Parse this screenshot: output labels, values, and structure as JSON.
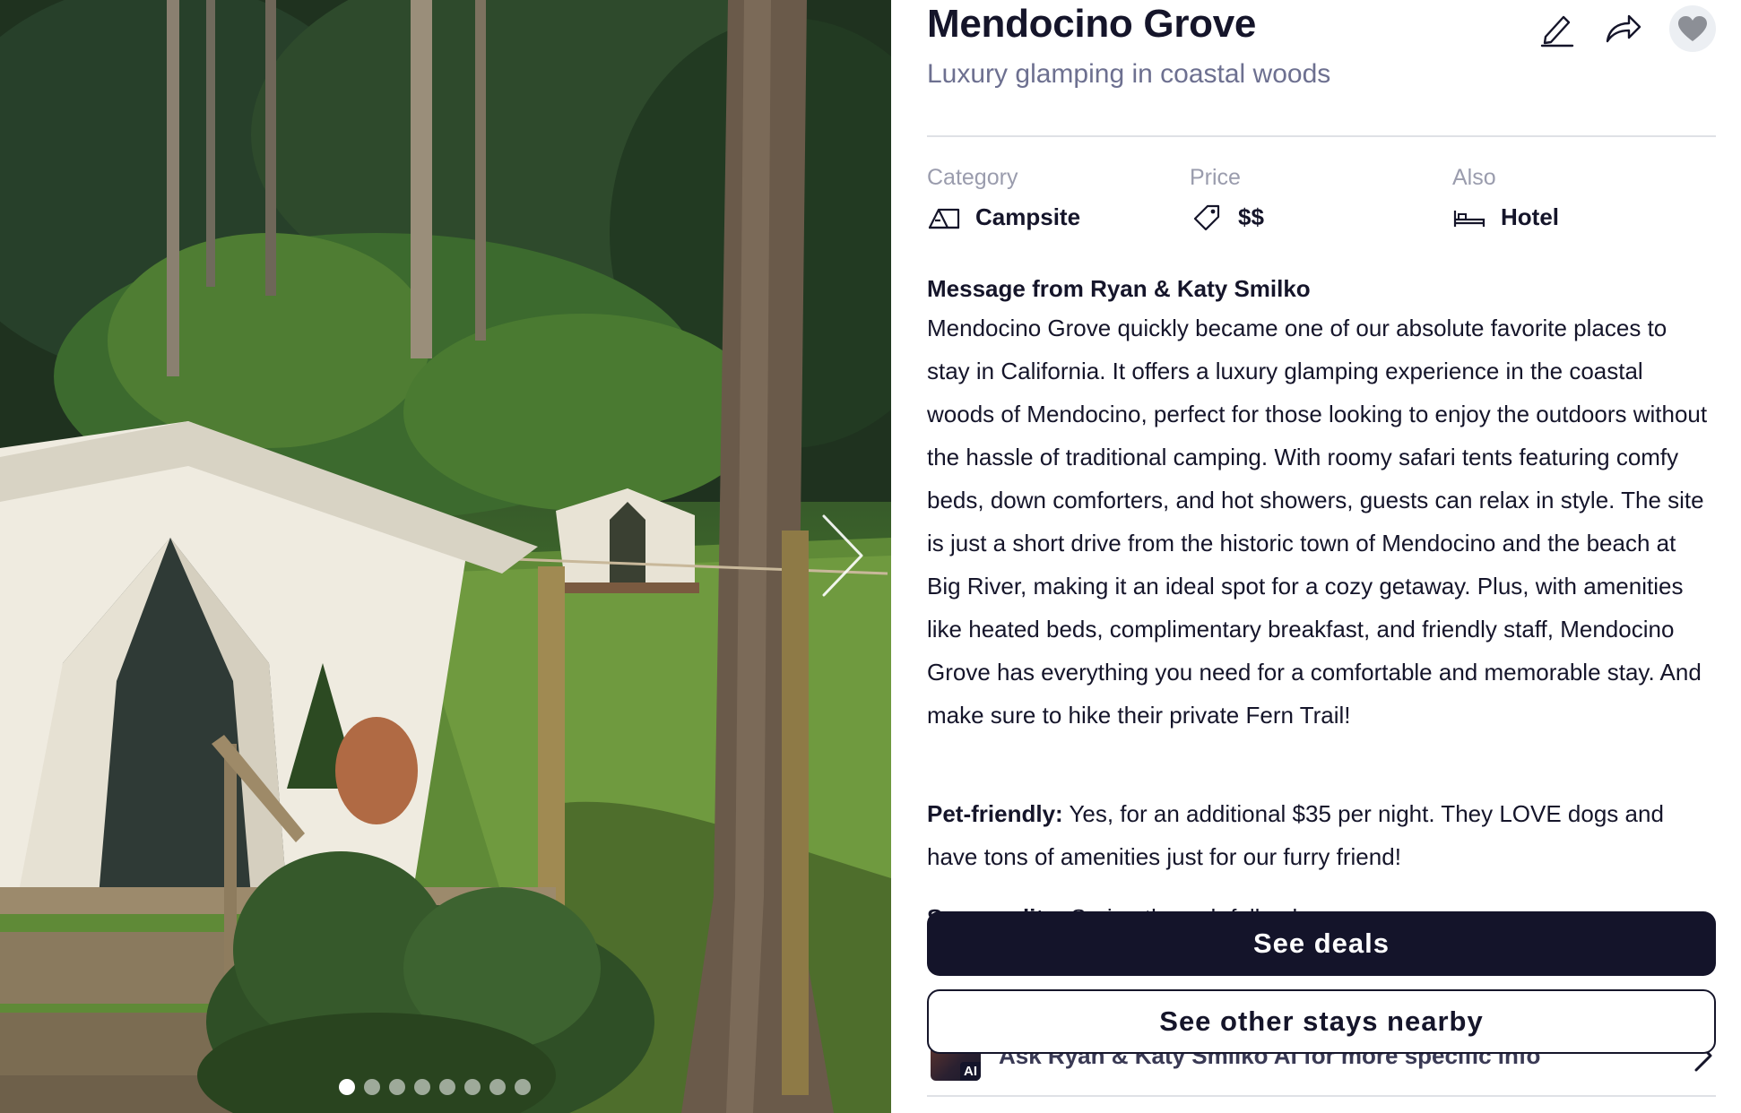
{
  "listing": {
    "title": "Mendocino Grove",
    "subtitle": "Luxury glamping in coastal woods"
  },
  "actions": {
    "edit_icon": "pencil-icon",
    "share_icon": "share-arrow-icon",
    "favorite_icon": "heart-icon"
  },
  "meta": [
    {
      "label": "Category",
      "value": "Campsite",
      "icon": "tent-icon"
    },
    {
      "label": "Price",
      "value": "$$",
      "icon": "price-tag-icon"
    },
    {
      "label": "Also",
      "value": "Hotel",
      "icon": "bed-icon"
    }
  ],
  "message": {
    "heading": "Message from Ryan & Katy Smilko",
    "body": "Mendocino Grove quickly became one of our absolute favorite places to stay in California. It offers a luxury glamping experience in the coastal woods of Mendocino, perfect for those looking to enjoy the outdoors without the hassle of traditional camping. With roomy safari tents featuring comfy beds, down comforters, and hot showers, guests can relax in style. The site is just a short drive from the historic town of Mendocino and the beach at Big River, making it an ideal spot for a cozy getaway. Plus, with amenities like heated beds, complimentary breakfast, and friendly staff, Mendocino Grove has everything you need for a comfortable and memorable stay. And make sure to hike their private Fern Trail!"
  },
  "pet_friendly": {
    "label": "Pet-friendly:",
    "text": " Yes, for an additional $35 per night. They LOVE dogs and have tons of amenities just for our furry friend!"
  },
  "seasonality": {
    "label": "Seasonality:",
    "text": " Spring through fall only"
  },
  "buttons": {
    "see_deals": "See deals",
    "see_other_stays": "See other stays nearby"
  },
  "ask_ai": {
    "badge": "AI",
    "text": "Ask Ryan & Katy Smilko AI for more specific info"
  },
  "carousel": {
    "total_images": 8,
    "active_index": 0,
    "next_icon": "chevron-right-icon"
  }
}
